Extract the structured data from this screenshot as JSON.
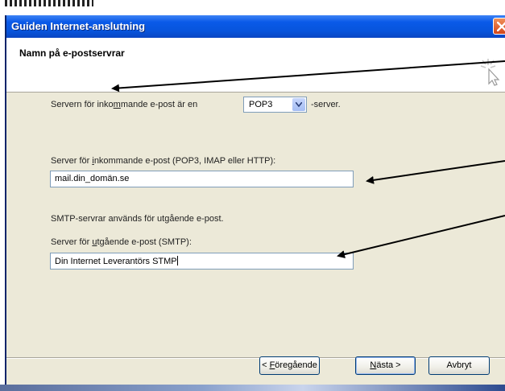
{
  "window": {
    "title": "Guiden Internet-anslutning"
  },
  "header": {
    "title": "Namn på e-postservrar"
  },
  "incoming_type": {
    "prefix": "Servern för inko",
    "underlined": "m",
    "suffix": "mande e-post är en",
    "selected": "POP3",
    "after": "-server."
  },
  "incoming_server": {
    "label_prefix": "Server för ",
    "label_underlined": "i",
    "label_suffix": "nkommande e-post (POP3, IMAP eller HTTP):",
    "value": "mail.din_domän.se"
  },
  "smtp_note": "SMTP-servrar används för utgående e-post.",
  "outgoing_server": {
    "label_prefix": "Server för ",
    "label_underlined": "u",
    "label_suffix": "tgående e-post (SMTP):",
    "value": "Din Internet Leverantörs STMP"
  },
  "buttons": {
    "back_prefix": "< ",
    "back_underlined": "F",
    "back_suffix": "öregående",
    "next_underlined": "N",
    "next_suffix": "ästa >",
    "cancel": "Avbryt"
  },
  "colors": {
    "title_bar": "#0754dc",
    "dialog_face": "#ece9d8",
    "close_button": "#d2461a"
  },
  "icons": [
    "close-icon",
    "dropdown-arrow-icon",
    "wizard-icon"
  ]
}
